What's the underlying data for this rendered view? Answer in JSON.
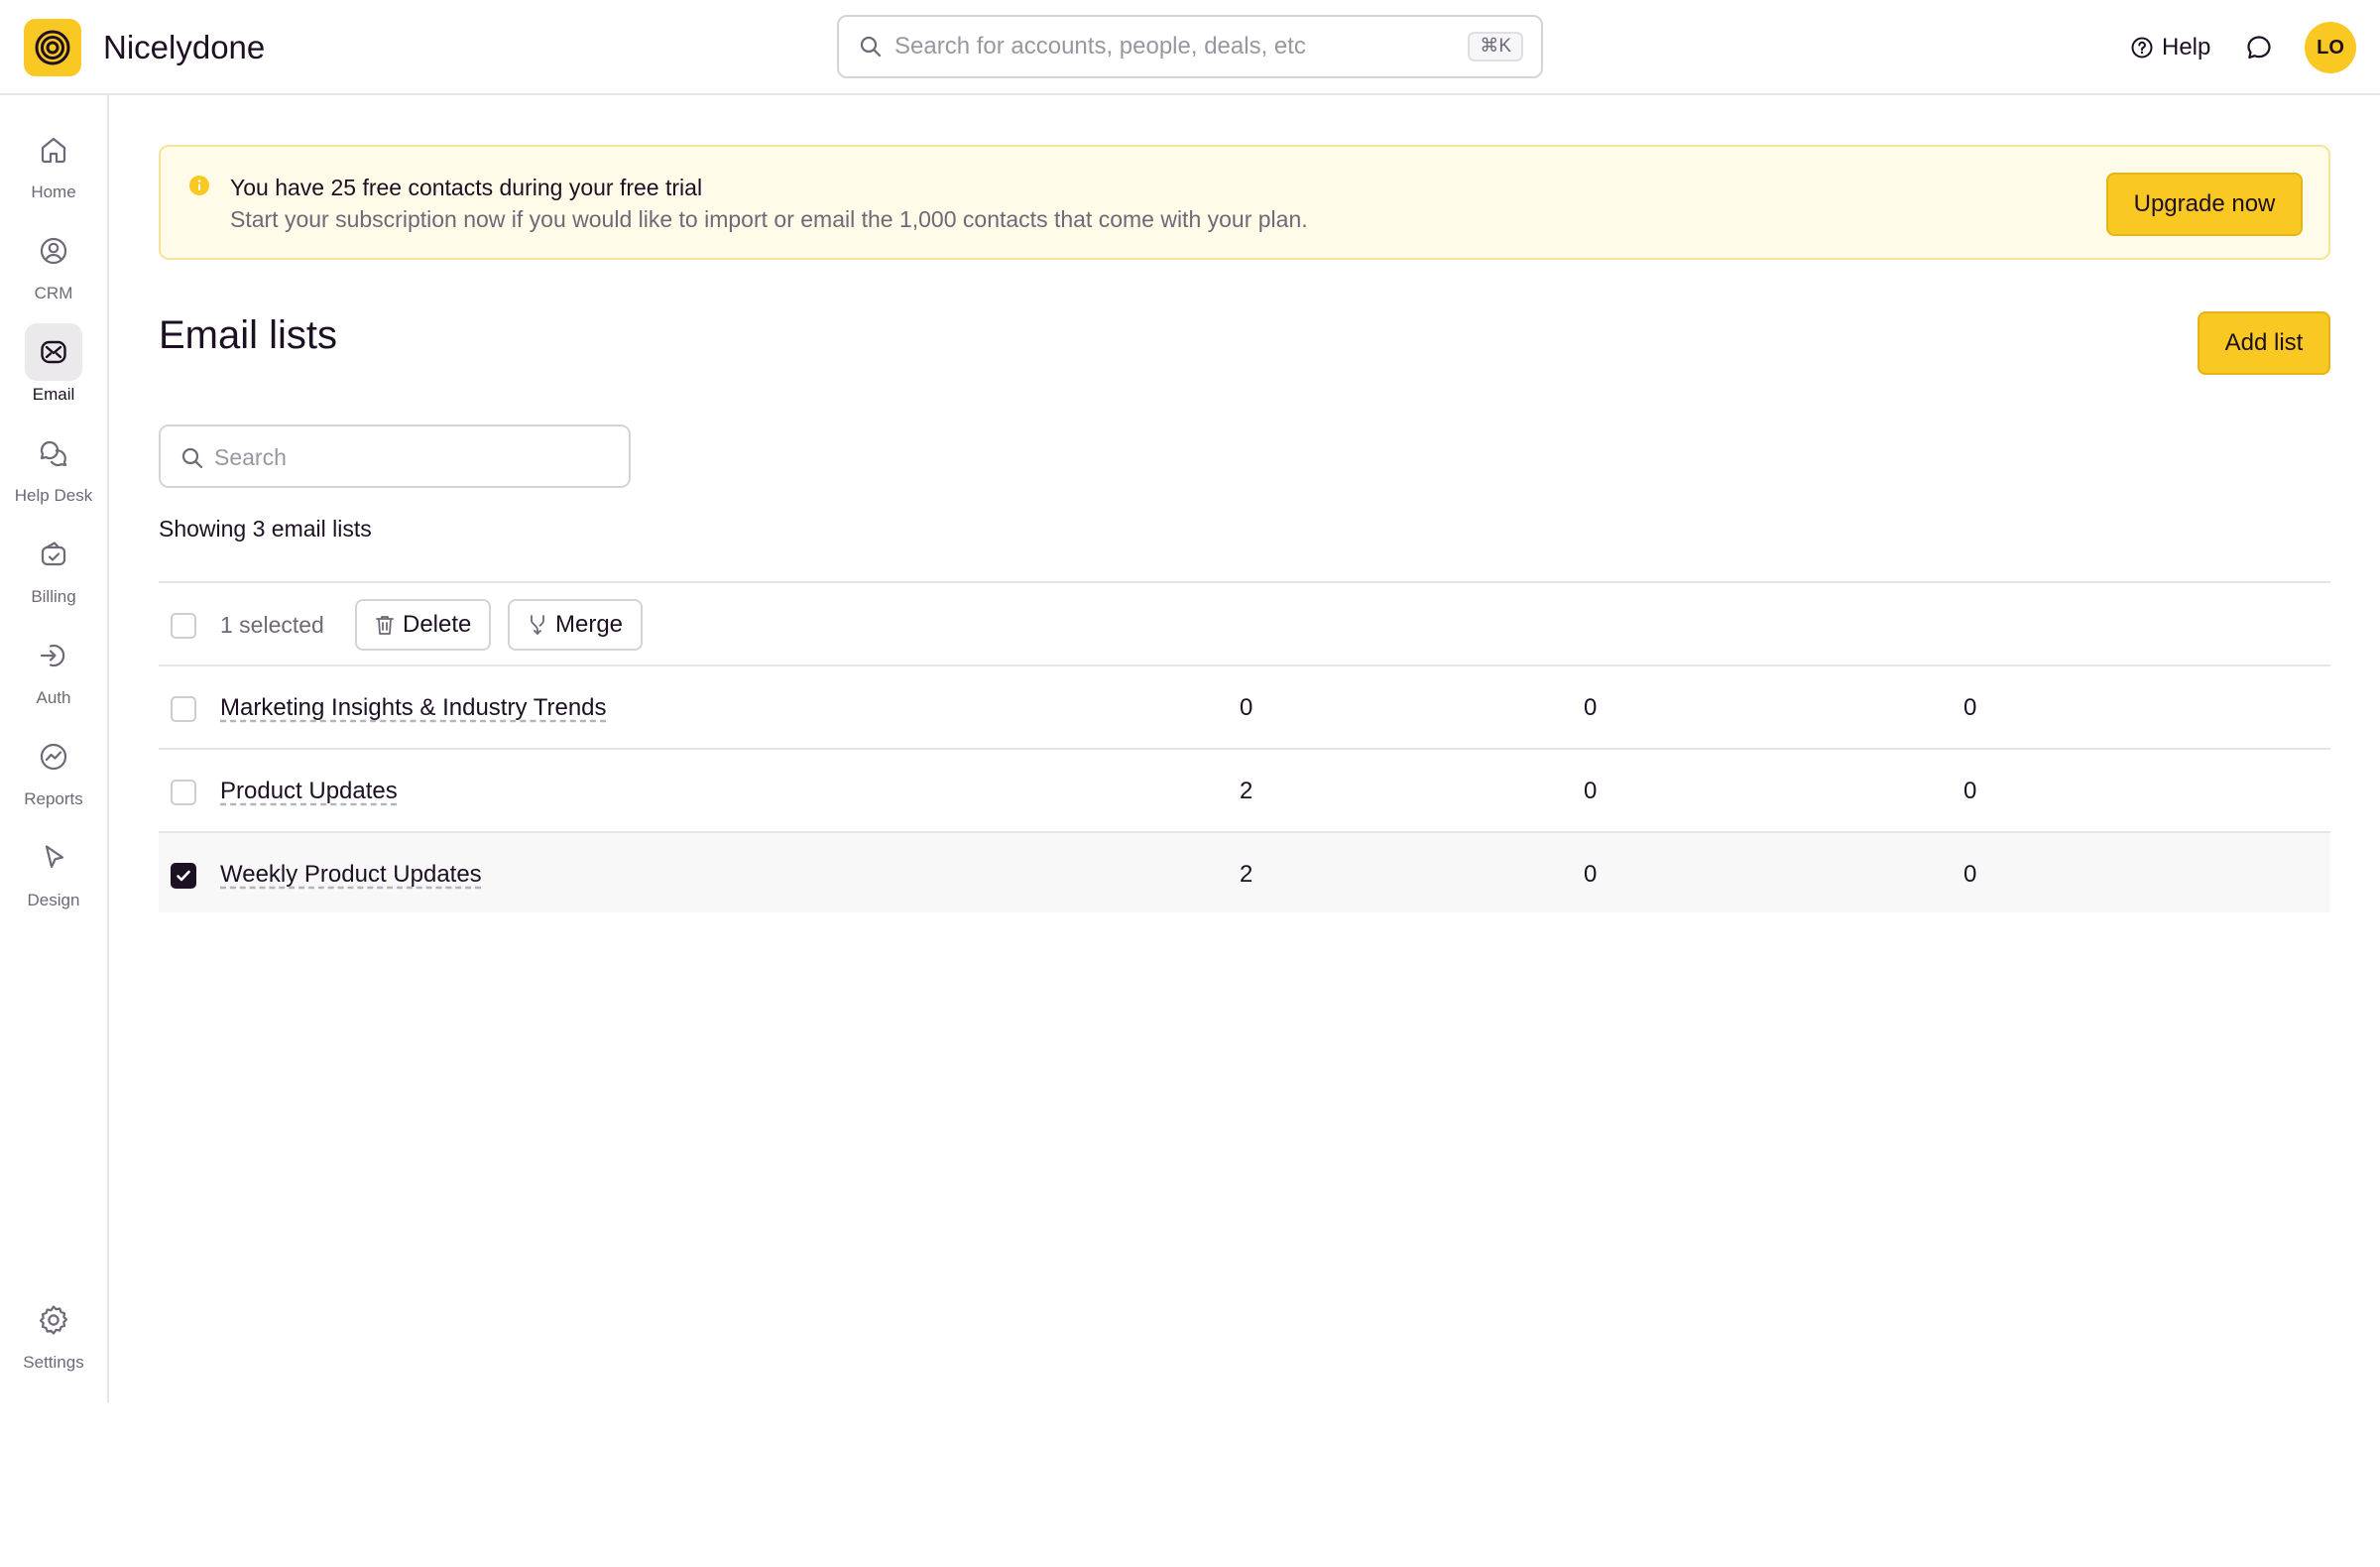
{
  "app": {
    "name": "Nicelydone"
  },
  "global_search": {
    "placeholder": "Search for accounts, people, deals, etc",
    "shortcut": "⌘K"
  },
  "header": {
    "help_label": "Help",
    "avatar_initials": "LO"
  },
  "sidebar": {
    "items": [
      {
        "label": "Home",
        "icon": "home-icon"
      },
      {
        "label": "CRM",
        "icon": "contact-icon"
      },
      {
        "label": "Email",
        "icon": "email-icon",
        "active": true
      },
      {
        "label": "Help Desk",
        "icon": "chat-bubbles-icon"
      },
      {
        "label": "Billing",
        "icon": "wallet-icon"
      },
      {
        "label": "Auth",
        "icon": "login-icon"
      },
      {
        "label": "Reports",
        "icon": "chart-icon"
      },
      {
        "label": "Design",
        "icon": "cursor-icon"
      }
    ],
    "settings_label": "Settings"
  },
  "banner": {
    "title": "You have 25 free contacts during your free trial",
    "text": "Start your subscription now if you would like to import or email the 1,000 contacts that come with your plan.",
    "cta": "Upgrade now"
  },
  "page": {
    "title": "Email lists",
    "add_button": "Add list",
    "search_placeholder": "Search",
    "showing": "Showing 3 email lists"
  },
  "bulk": {
    "selected_label": "1 selected",
    "delete_label": "Delete",
    "merge_label": "Merge"
  },
  "lists": [
    {
      "name": "Marketing Insights & Industry Trends",
      "c1": "0",
      "c2": "0",
      "c3": "0",
      "checked": false
    },
    {
      "name": "Product Updates",
      "c1": "2",
      "c2": "0",
      "c3": "0",
      "checked": false
    },
    {
      "name": "Weekly Product Updates",
      "c1": "2",
      "c2": "0",
      "c3": "0",
      "checked": true
    }
  ],
  "colors": {
    "accent": "#f9c823",
    "text": "#1d1022",
    "muted": "#6f6876",
    "border": "#e7e5e8"
  }
}
